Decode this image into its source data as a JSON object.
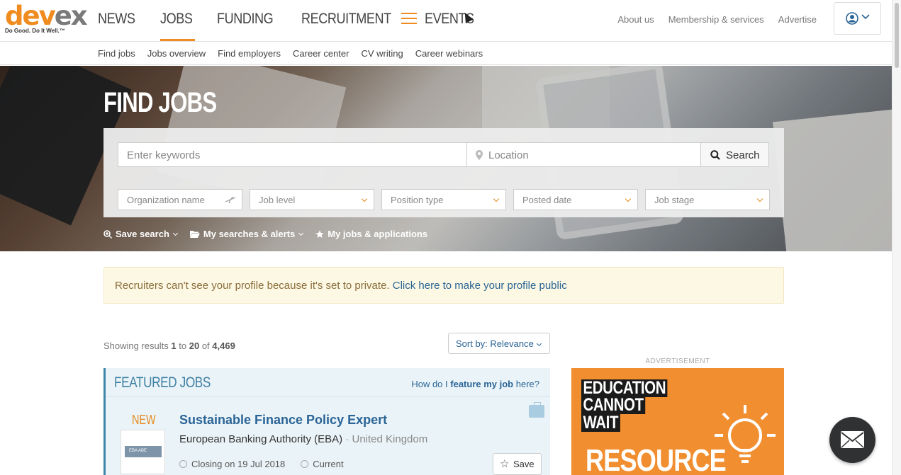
{
  "brand": {
    "logo_dev": "dev",
    "logo_ex": "ex",
    "tagline": "Do Good. Do It Well.™"
  },
  "main_nav": [
    {
      "label": "NEWS",
      "active": false
    },
    {
      "label": "JOBS",
      "active": true
    },
    {
      "label": "FUNDING",
      "active": false
    },
    {
      "label": "RECRUITMENT",
      "active": false
    },
    {
      "label": "EVENTS",
      "active": false
    }
  ],
  "right_links": [
    "About us",
    "Membership & services",
    "Advertise"
  ],
  "sub_nav": [
    "Find jobs",
    "Jobs overview",
    "Find employers",
    "Career center",
    "CV writing",
    "Career webinars"
  ],
  "hero": {
    "title": "FIND JOBS",
    "keywords_placeholder": "Enter keywords",
    "location_placeholder": "Location",
    "search_label": "Search",
    "filters": [
      "Organization name",
      "Job level",
      "Position type",
      "Posted date",
      "Job stage"
    ],
    "tools": [
      "Save search",
      "My searches & alerts",
      "My jobs & applications"
    ]
  },
  "alert": {
    "text": "Recruiters can't see your profile because it's set to private.",
    "link": "Click here to make your profile public"
  },
  "results": {
    "prefix": "Showing results",
    "from": "1",
    "to_word": "to",
    "to": "20",
    "of_word": "of",
    "total": "4,469"
  },
  "sort": {
    "label": "Sort by: Relevance"
  },
  "featured": {
    "title": "FEATURED JOBS",
    "help_pre": "How do I",
    "help_bold": "feature my job",
    "help_post": "here?"
  },
  "job": {
    "badge": "NEW",
    "logo_text": "EBA ABE",
    "title": "Sustainable Finance Policy Expert",
    "company": "European Banking Authority (EBA)",
    "separator": " · ",
    "location": "United Kingdom",
    "closing": "Closing on 19 Jul 2018",
    "stage": "Current",
    "save_label": "Save"
  },
  "ad": {
    "label": "ADVERTISEMENT",
    "line1": "EDUCATION",
    "line2": "CANNOT",
    "line3": "WAIT",
    "line4": "RESOURCE"
  },
  "colors": {
    "accent": "#f08c1f",
    "link": "#2a6496",
    "featured_bg": "#eaf4f8",
    "ad_bg": "#f18e30"
  }
}
